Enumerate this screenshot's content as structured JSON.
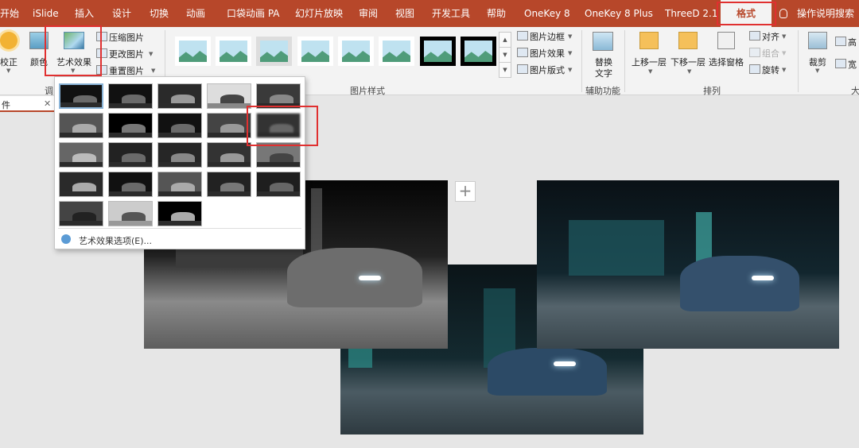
{
  "tabs": [
    {
      "label": "开始"
    },
    {
      "label": "iSlide"
    },
    {
      "label": "插入"
    },
    {
      "label": "设计"
    },
    {
      "label": "切换"
    },
    {
      "label": "动画"
    },
    {
      "label": "口袋动画 PA"
    },
    {
      "label": "幻灯片放映"
    },
    {
      "label": "审阅"
    },
    {
      "label": "视图"
    },
    {
      "label": "开发工具"
    },
    {
      "label": "帮助"
    },
    {
      "label": "OneKey 8"
    },
    {
      "label": "OneKey 8 Plus"
    },
    {
      "label": "ThreeD 2.1"
    },
    {
      "label": "格式"
    }
  ],
  "tell_me": "操作说明搜索",
  "ribbon": {
    "adjust": {
      "correct": "校正",
      "color": "颜色",
      "artistic": "艺术效果",
      "compress": "压缩图片",
      "change": "更改图片",
      "reset": "重置图片",
      "group": "调"
    },
    "styles": {
      "border": "图片边框",
      "effects": "图片效果",
      "layout": "图片版式",
      "group": "图片样式"
    },
    "accessibility": {
      "alt_text_line1": "替换",
      "alt_text_line2": "文字",
      "group": "辅助功能"
    },
    "arrange": {
      "forward": "上移一层",
      "backward": "下移一层",
      "selection": "选择窗格",
      "align": "对齐",
      "group_btn": "组合",
      "rotate": "旋转",
      "group": "排列"
    },
    "size": {
      "crop": "裁剪",
      "height": "高",
      "width": "宽",
      "group": "大"
    }
  },
  "file_tab": "件",
  "dropdown": {
    "options_link": "艺术效果选项(E)..."
  },
  "colors": {
    "accent": "#b7472a",
    "highlight": "#e03030"
  }
}
